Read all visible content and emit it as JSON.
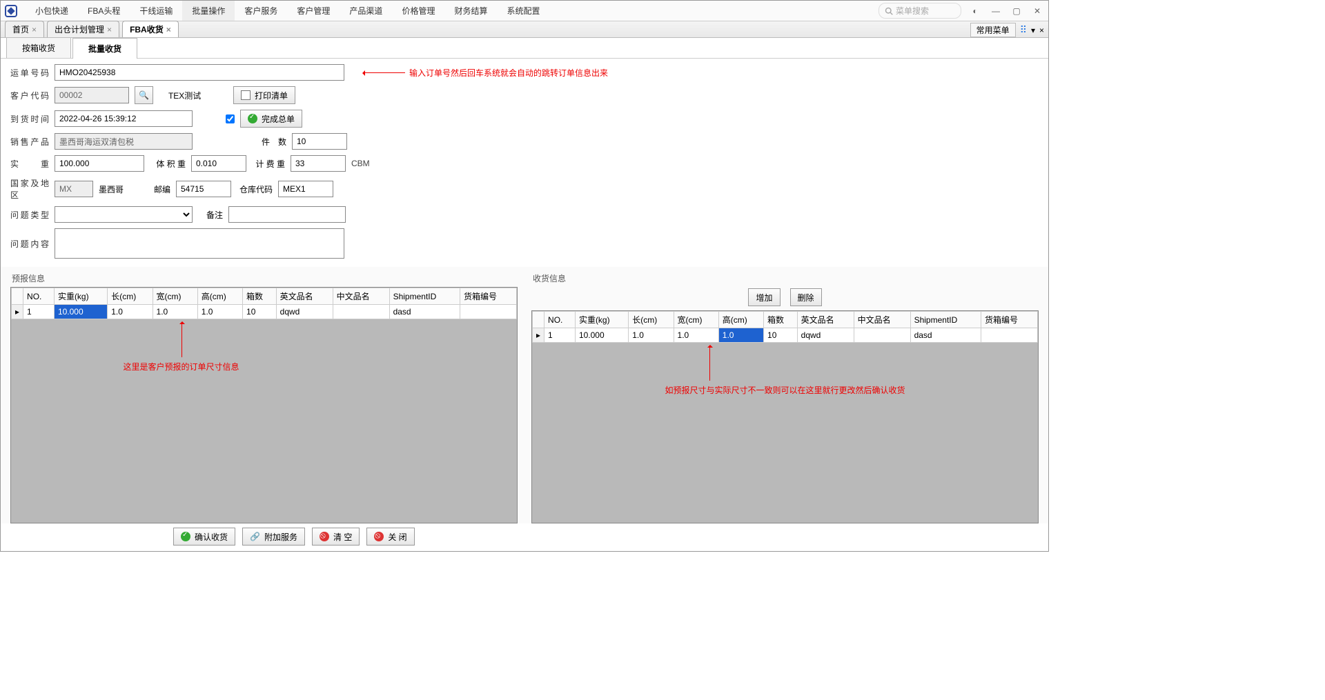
{
  "menu": {
    "items": [
      "小包快递",
      "FBA头程",
      "干线运输",
      "批量操作",
      "客户服务",
      "客户管理",
      "产品渠道",
      "价格管理",
      "财务结算",
      "系统配置"
    ],
    "active_index": 3
  },
  "search": {
    "placeholder": "菜单搜索"
  },
  "doc_tabs": {
    "items": [
      {
        "label": "首页"
      },
      {
        "label": "出仓计划管理"
      },
      {
        "label": "FBA收货"
      }
    ],
    "active_index": 2,
    "right_label": "常用菜单"
  },
  "sub_tabs": {
    "items": [
      "按箱收货",
      "批量收货"
    ],
    "active_index": 1
  },
  "form": {
    "waybill_label": "运单号码",
    "waybill_value": "HMO20425938",
    "customer_label": "客户代码",
    "customer_value": "00002",
    "customer_name": "TEX测试",
    "print_label": "打印清单",
    "arrive_label": "到货时间",
    "arrive_value": "2022-04-26 15:39:12",
    "complete_label": "完成总单",
    "product_label": "销售产品",
    "product_value": "墨西哥海运双清包税",
    "pieces_label": "件　数",
    "pieces_value": "10",
    "weight_label": "实　重",
    "weight_value": "100.000",
    "volweight_label": "体 积 重",
    "volweight_value": "0.010",
    "bill_label": "计 费 重",
    "bill_value": "33",
    "cbm": "CBM",
    "country_label": "国家及地区",
    "country_code": "MX",
    "country_name": "墨西哥",
    "post_label": "邮编",
    "post_value": "54715",
    "wh_label": "仓库代码",
    "wh_value": "MEX1",
    "issue_type_label": "问题类型",
    "remark_label": "备注",
    "issue_content_label": "问题内容"
  },
  "annot1": "输入订单号然后回车系统就会自动的跳转订单信息出来",
  "left_panel": {
    "title": "预报信息",
    "headers": [
      "NO.",
      "实重(kg)",
      "长(cm)",
      "宽(cm)",
      "高(cm)",
      "箱数",
      "英文品名",
      "中文品名",
      "ShipmentID",
      "货箱编号"
    ],
    "row": {
      "no": "1",
      "w": "10.000",
      "l": "1.0",
      "wd": "1.0",
      "h": "1.0",
      "box": "10",
      "en": "dqwd",
      "cn": "",
      "sid": "dasd",
      "cargo": ""
    },
    "annot": "这里是客户预报的订单尺寸信息"
  },
  "right_panel": {
    "title": "收货信息",
    "btn_add": "增加",
    "btn_del": "删除",
    "headers": [
      "NO.",
      "实重(kg)",
      "长(cm)",
      "宽(cm)",
      "高(cm)",
      "箱数",
      "英文品名",
      "中文品名",
      "ShipmentID",
      "货箱编号"
    ],
    "row": {
      "no": "1",
      "w": "10.000",
      "l": "1.0",
      "wd": "1.0",
      "h": "1.0",
      "box": "10",
      "en": "dqwd",
      "cn": "",
      "sid": "dasd",
      "cargo": ""
    },
    "annot": "如预报尺寸与实际尺寸不一致则可以在这里就行更改然后确认收货"
  },
  "bottom": {
    "confirm": "确认收货",
    "extra": "附加服务",
    "clear": "清 空",
    "close": "关 闭"
  }
}
